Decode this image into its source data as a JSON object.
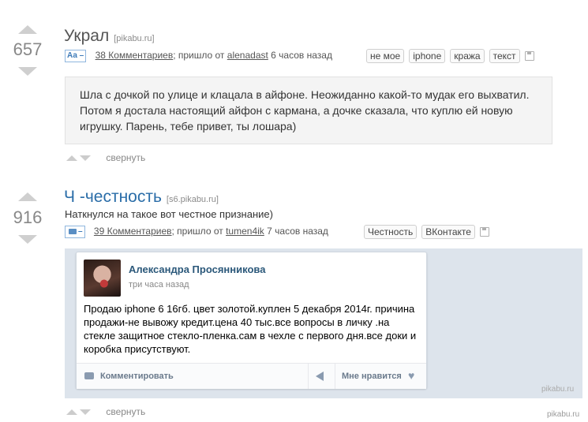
{
  "post1": {
    "rating": "657",
    "title": "Украл",
    "domain": "[pikabu.ru]",
    "badge": "Аа –",
    "comments": "38 Комментариев",
    "via_text": "; пришло от",
    "author": "alenadast",
    "time": "6 часов назад",
    "tags": [
      "не мое",
      "iphone",
      "кража",
      "текст"
    ],
    "body": "Шла с дочкой по улице и клацала в айфоне. Неожиданно какой-то мудак его выхватил. Потом я достала настоящий айфон с кармана, а дочке сказала, что куплю ей новую игрушку. Парень, тебе привет, ты лошара)",
    "collapse": "свернуть"
  },
  "post2": {
    "rating": "916",
    "title": "Ч -честность",
    "domain": "[s6.pikabu.ru]",
    "subtitle": "Наткнулся на такое вот честное признание)",
    "badge": "–",
    "comments": "39 Комментариев",
    "via_text": "; пришло от",
    "author": "tumen4ik",
    "time": "7 часов назад",
    "tags": [
      "Честность",
      "ВКонтакте"
    ],
    "collapse": "свернуть"
  },
  "vk": {
    "name": "Александра Просянникова",
    "time": "три часа назад",
    "text": "Продаю iphone 6 16гб. цвет золотой.куплен 5 декабря 2014г. причина продажи-не вывожу кредит.цена 40 тыс.все вопросы в личку .на стекле защитное стекло-пленка.сам в чехле с первого дня.все доки и коробка присутствуют.",
    "comment_label": "Комментировать",
    "like_label": "Мне нравится",
    "watermark": "pikabu.ru"
  },
  "footer_watermark": "pikabu.ru"
}
